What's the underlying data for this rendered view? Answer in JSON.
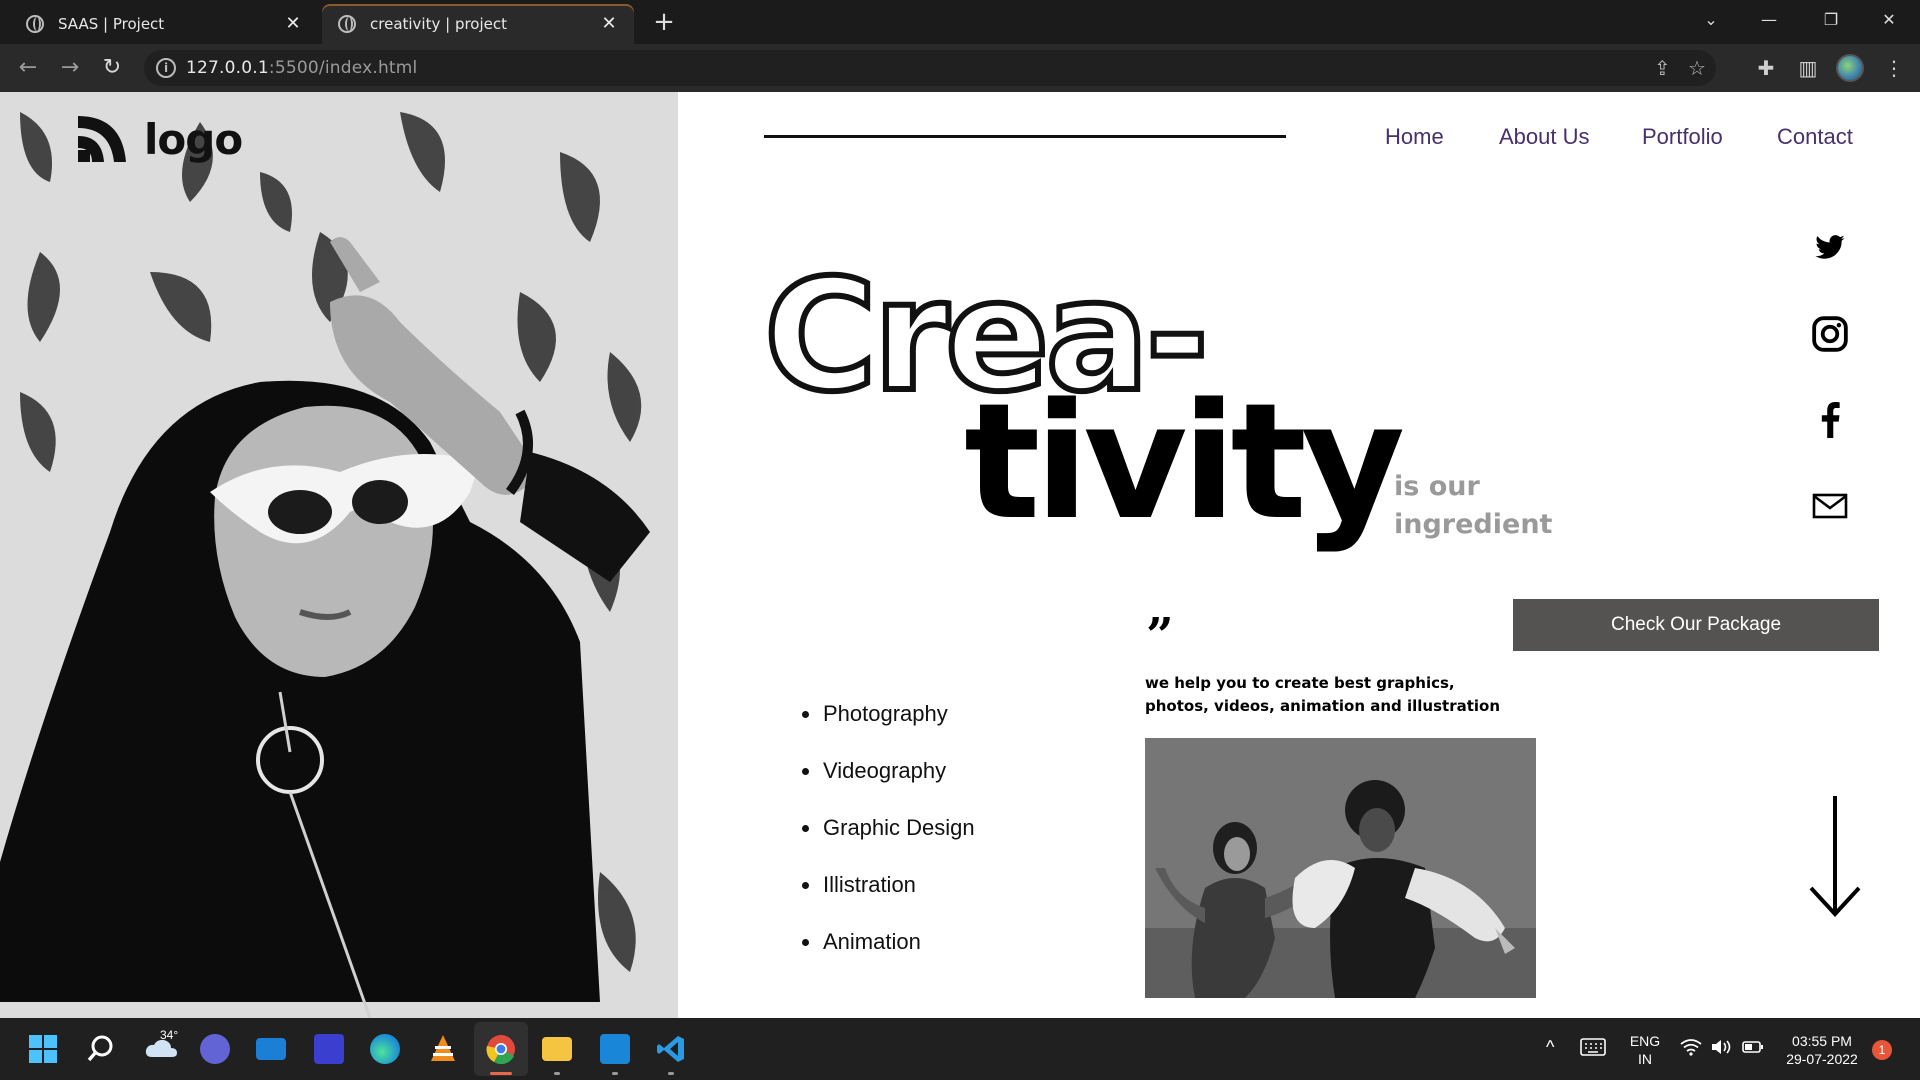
{
  "browser": {
    "tabs": [
      {
        "title": "SAAS | Project",
        "active": false
      },
      {
        "title": "creativity | project",
        "active": true
      }
    ],
    "url_host": "127.0.0.1",
    "url_rest": ":5500/index.html"
  },
  "site": {
    "logo_text": "logo",
    "nav": [
      "Home",
      "About Us",
      "Portfolio",
      "Contact"
    ],
    "headline_outline": "Crea-",
    "headline_solid": "tivity",
    "headline_sub": "is our ingredient",
    "quote_mark": "”",
    "tagline": "we help you to create best graphics, photos, videos, animation and illustration",
    "cta_label": "Check Our Package",
    "services": [
      "Photography",
      "Videography",
      "Graphic Design",
      "Illistration",
      "Animation"
    ],
    "social_icons": [
      "twitter-icon",
      "instagram-icon",
      "facebook-icon",
      "mail-icon"
    ]
  },
  "taskbar": {
    "weather": "34°",
    "lang_top": "ENG",
    "lang_bottom": "IN",
    "time": "03:55 PM",
    "date": "29-07-2022",
    "notifications": "1"
  },
  "colors": {
    "nav_text": "#47306e",
    "cta_bg": "#555252",
    "subtitle_gray": "#9a9a9a"
  }
}
